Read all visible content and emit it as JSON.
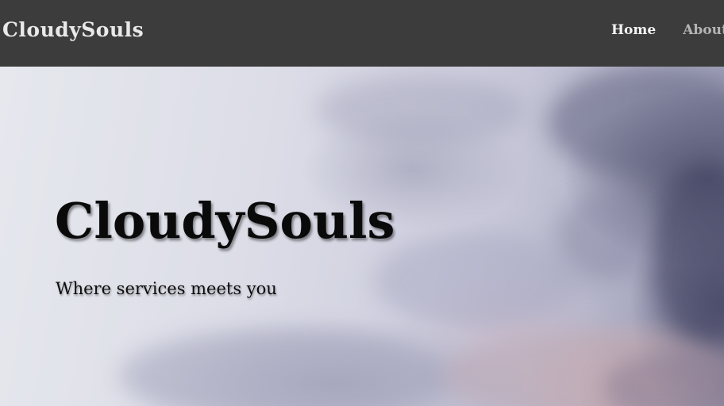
{
  "navbar": {
    "brand": "CloudySouls",
    "links": [
      {
        "label": "Home",
        "active": true
      },
      {
        "label": "About",
        "active": false
      }
    ]
  },
  "hero": {
    "title": "CloudySouls",
    "subtitle": "Where services meets you",
    "background_image": "sky-clouds-at-dusk"
  },
  "colors": {
    "navbar_bg": "#3c3c3c",
    "brand_text": "#e9e9e9",
    "nav_active": "#f4f4f4",
    "nav_inactive": "#b4b4b4",
    "hero_text": "#0a0a0a"
  }
}
